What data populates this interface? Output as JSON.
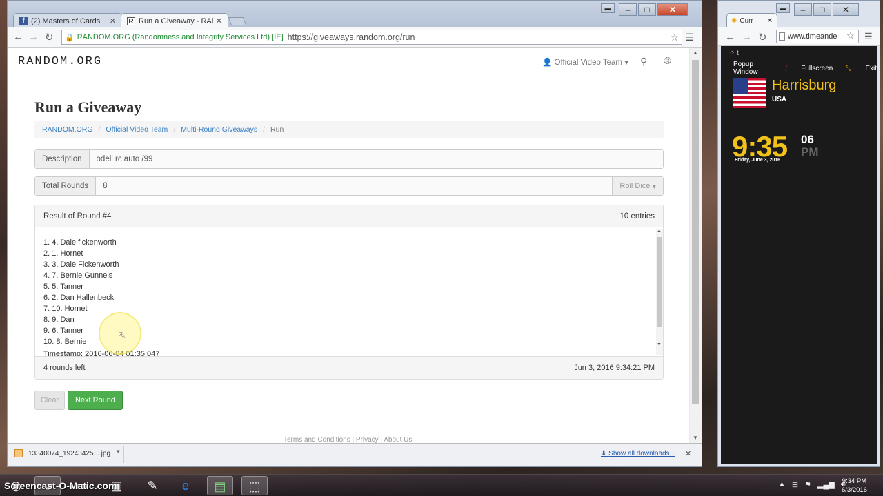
{
  "main_browser": {
    "tabs": [
      {
        "title": "(2) Masters of Cards",
        "favicon": "facebook-icon"
      },
      {
        "title": "Run a Giveaway - RANDO",
        "favicon": "random-org-icon"
      }
    ],
    "ev_label": "RANDOM.ORG (Randomness and Integrity Services Ltd) [IE]",
    "url": "https://giveaways.random.org/run"
  },
  "site": {
    "brand": "RANDOM.ORG",
    "user_menu": "Official Video Team"
  },
  "page": {
    "title": "Run a Giveaway",
    "breadcrumb": [
      "RANDOM.ORG",
      "Official Video Team",
      "Multi-Round Giveaways",
      "Run"
    ],
    "description_label": "Description",
    "description_value": "odell rc auto /99",
    "total_rounds_label": "Total Rounds",
    "total_rounds_value": "8",
    "roll_dice_label": "Roll Dice"
  },
  "result": {
    "heading": "Result of Round #4",
    "entries": "10 entries",
    "items": [
      "1. 4. Dale fickenworth",
      "2. 1. Hornet",
      "3. 3. Dale Fickenworth",
      "4. 7. Bernie Gunnels",
      "5. 5. Tanner",
      "6. 2. Dan Hallenbeck",
      "7. 10. Hornet",
      "8. 9. Dan",
      "9. 6. Tanner",
      "10. 8. Bernie"
    ],
    "timestamp": "Timestamp: 2016-06-04 01:35:047",
    "rounds_left": "4 rounds left",
    "datetime": "Jun 3, 2016 9:34:21 PM"
  },
  "buttons": {
    "clear": "Clear",
    "next_round": "Next Round"
  },
  "footer": {
    "links": "Terms and Conditions | Privacy | About Us"
  },
  "download_bar": {
    "filename": "13340074_19243425....jpg",
    "show_all": "Show all downloads..."
  },
  "side_browser": {
    "tab_title": "Curr",
    "url": "www.timeande",
    "menu": [
      "Popup Window",
      "Fullscreen",
      "Exit"
    ],
    "city": "Harrisburg",
    "country": "USA",
    "time": "9:35",
    "seconds": "06",
    "ampm": "PM",
    "date": "Friday, June 3, 2016"
  },
  "taskbar": {
    "watermark": "Screencast-O-Matic.com",
    "time": "9:34 PM",
    "date": "6/3/2016"
  },
  "colors": {
    "link": "#3a7fc1",
    "success": "#4cae4c",
    "clock_yellow": "#f2c21b",
    "ev_green": "#1e8a32"
  }
}
